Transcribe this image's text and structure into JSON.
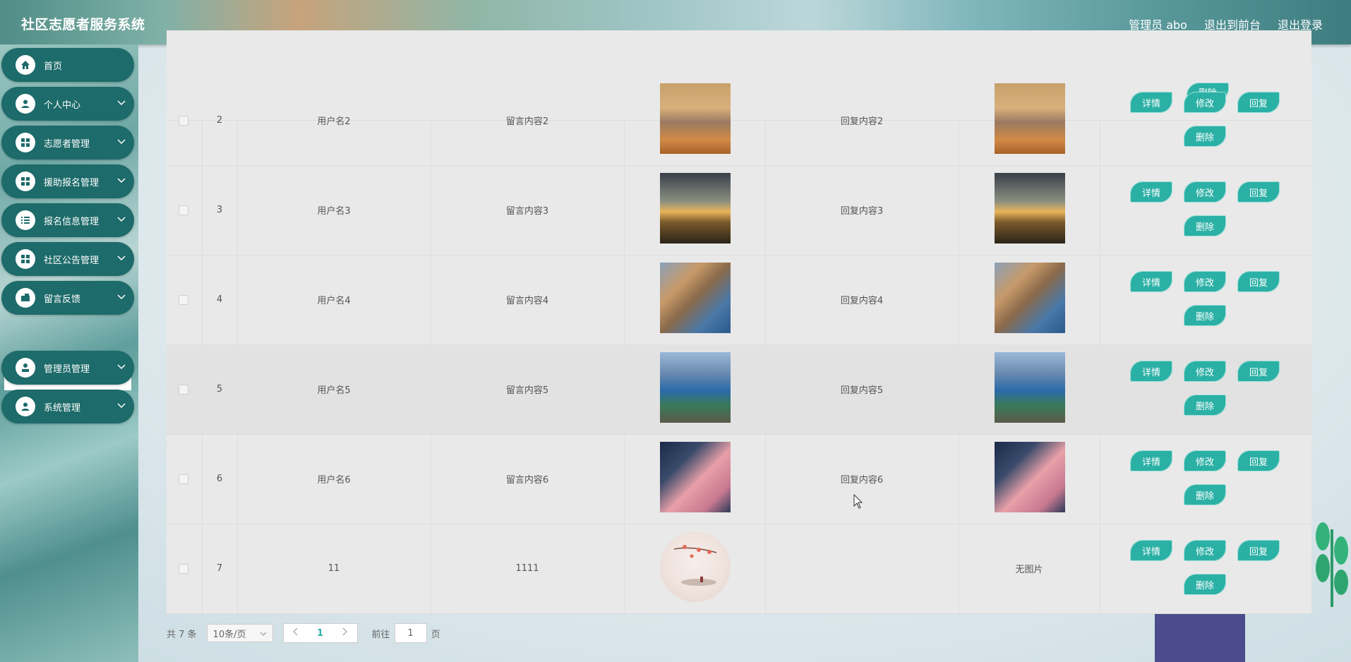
{
  "header": {
    "title": "社区志愿者服务系统",
    "admin_label": "管理员 abo",
    "to_frontend": "退出到前台",
    "logout": "退出登录"
  },
  "sidebar": {
    "items": [
      {
        "label": "首页",
        "icon": "home-icon"
      },
      {
        "label": "个人中心",
        "icon": "user-icon"
      },
      {
        "label": "志愿者管理",
        "icon": "grid-icon"
      },
      {
        "label": "援助报名管理",
        "icon": "grid-icon"
      },
      {
        "label": "报名信息管理",
        "icon": "list-icon"
      },
      {
        "label": "社区公告管理",
        "icon": "grid-icon"
      },
      {
        "label": "留言反馈",
        "icon": "message-icon"
      },
      {
        "label": "管理员管理",
        "icon": "admin-icon"
      },
      {
        "label": "系统管理",
        "icon": "user-icon"
      }
    ],
    "submenu_active": "留言反馈"
  },
  "table": {
    "top_partial_button": "删除",
    "rows": [
      {
        "index": "2",
        "username": "用户名2",
        "content": "留言内容2",
        "reply": "回复内容2",
        "reply_image": ""
      },
      {
        "index": "3",
        "username": "用户名3",
        "content": "留言内容3",
        "reply": "回复内容3",
        "reply_image": ""
      },
      {
        "index": "4",
        "username": "用户名4",
        "content": "留言内容4",
        "reply": "回复内容4",
        "reply_image": ""
      },
      {
        "index": "5",
        "username": "用户名5",
        "content": "留言内容5",
        "reply": "回复内容5",
        "reply_image": ""
      },
      {
        "index": "6",
        "username": "用户名6",
        "content": "留言内容6",
        "reply": "回复内容6",
        "reply_image": ""
      },
      {
        "index": "7",
        "username": "11",
        "content": "1111",
        "reply": "",
        "reply_image": "无图片"
      }
    ],
    "actions": {
      "detail": "详情",
      "edit": "修改",
      "reply": "回复",
      "delete": "删除"
    }
  },
  "pager": {
    "total": "共 7 条",
    "page_size": "10条/页",
    "current": "1",
    "goto_prefix": "前往",
    "goto_value": "1",
    "goto_suffix": "页"
  },
  "colors": {
    "accent": "#2bb0a5",
    "menu": "#1d6b6a"
  }
}
